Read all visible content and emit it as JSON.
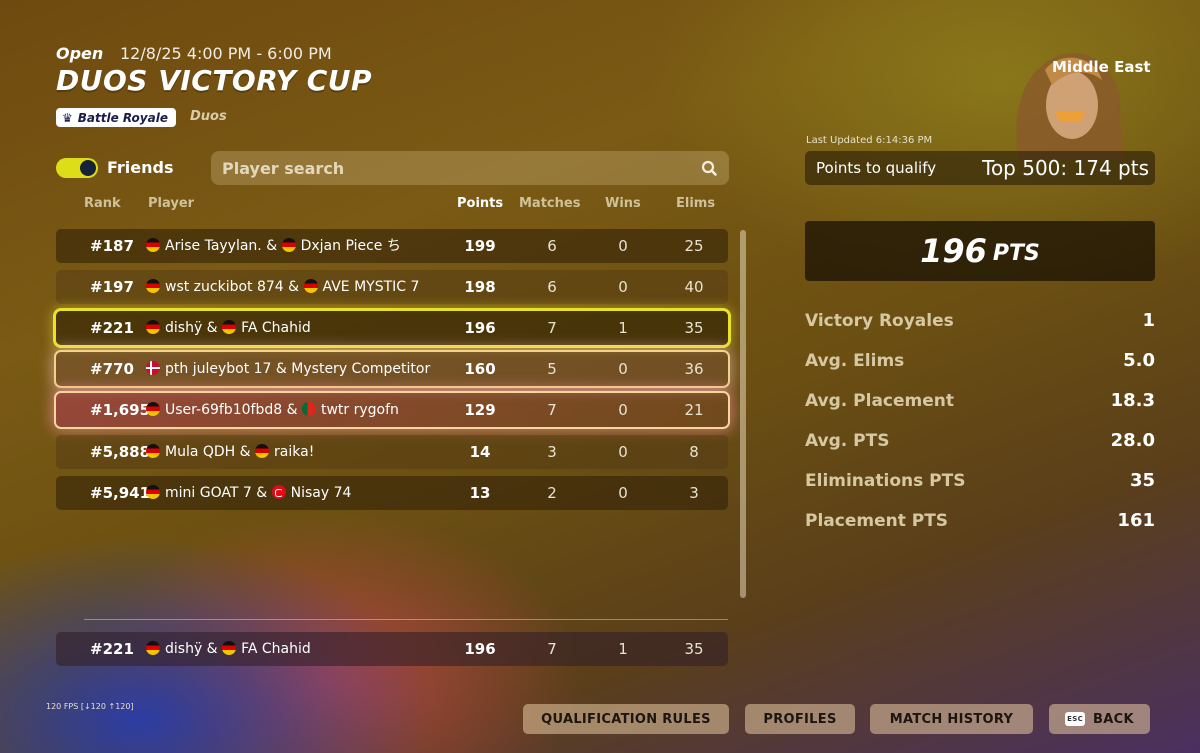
{
  "header": {
    "status": "Open",
    "datetime": "12/8/25 4:00 PM - 6:00 PM",
    "title": "DUOS VICTORY CUP",
    "badge": "Battle Royale",
    "mode": "Duos"
  },
  "filters": {
    "friends_label": "Friends",
    "friends_on": true,
    "search_placeholder": "Player search"
  },
  "columns": {
    "rank": "Rank",
    "player": "Player",
    "points": "Points",
    "matches": "Matches",
    "wins": "Wins",
    "elims": "Elims"
  },
  "rows": [
    {
      "rank": "#187",
      "p1_flag": "de",
      "p1": "Arise Tayylan.",
      "p2_flag": "de",
      "p2": "Dxjan Piece ち",
      "points": "199",
      "matches": "6",
      "wins": "0",
      "elims": "25"
    },
    {
      "rank": "#197",
      "p1_flag": "de",
      "p1": "wst zuckibot 874",
      "p2_flag": "de",
      "p2": "AVE MYSTIC 7",
      "points": "198",
      "matches": "6",
      "wins": "0",
      "elims": "40"
    },
    {
      "rank": "#221",
      "p1_flag": "de",
      "p1": "dishÿ",
      "p2_flag": "de",
      "p2": "FA Chahid",
      "points": "196",
      "matches": "7",
      "wins": "1",
      "elims": "35"
    },
    {
      "rank": "#770",
      "p1_flag": "dk",
      "p1": "pth juleybot 17",
      "p2_flag": "",
      "p2": "Mystery Competitor",
      "points": "160",
      "matches": "5",
      "wins": "0",
      "elims": "36"
    },
    {
      "rank": "#1,695",
      "p1_flag": "de",
      "p1": "User-69fb10fbd8",
      "p2_flag": "pt",
      "p2": "twtr rygofn",
      "points": "129",
      "matches": "7",
      "wins": "0",
      "elims": "21"
    },
    {
      "rank": "#5,888",
      "p1_flag": "de",
      "p1": "Mula QDH",
      "p2_flag": "de",
      "p2": "raika!",
      "points": "14",
      "matches": "3",
      "wins": "0",
      "elims": "8"
    },
    {
      "rank": "#5,941",
      "p1_flag": "de",
      "p1": "mini GOAT 7",
      "p2_flag": "tr",
      "p2": "Nisay 74",
      "points": "13",
      "matches": "2",
      "wins": "0",
      "elims": "3"
    }
  ],
  "self_row": {
    "rank": "#221",
    "p1_flag": "de",
    "p1": "dishÿ",
    "p2_flag": "de",
    "p2": "FA Chahid",
    "points": "196",
    "matches": "7",
    "wins": "1",
    "elims": "35"
  },
  "panel": {
    "region": "Middle East",
    "last_updated": "Last Updated 6:14:36 PM",
    "qualify_label": "Points to qualify",
    "qualify_value": "Top 500: 174 pts",
    "total_points": "196",
    "total_unit": "PTS",
    "stats": [
      {
        "label": "Victory Royales",
        "value": "1"
      },
      {
        "label": "Avg. Elims",
        "value": "5.0"
      },
      {
        "label": "Avg. Placement",
        "value": "18.3"
      },
      {
        "label": "Avg. PTS",
        "value": "28.0"
      },
      {
        "label": "Eliminations PTS",
        "value": "35"
      },
      {
        "label": "Placement PTS",
        "value": "161"
      }
    ]
  },
  "footer": {
    "fps": "120 FPS [↓120 ↑120]",
    "buttons": {
      "qualification_rules": "QUALIFICATION RULES",
      "profiles": "PROFILES",
      "match_history": "MATCH HISTORY",
      "esc": "ESC",
      "back": "BACK"
    }
  },
  "colors": {
    "highlight_yellow": "#e9e326",
    "toggle": "#ddde17",
    "accent_gold": "#f3d389"
  },
  "icons": {
    "search": "search-icon",
    "badge": "crown-icon"
  }
}
